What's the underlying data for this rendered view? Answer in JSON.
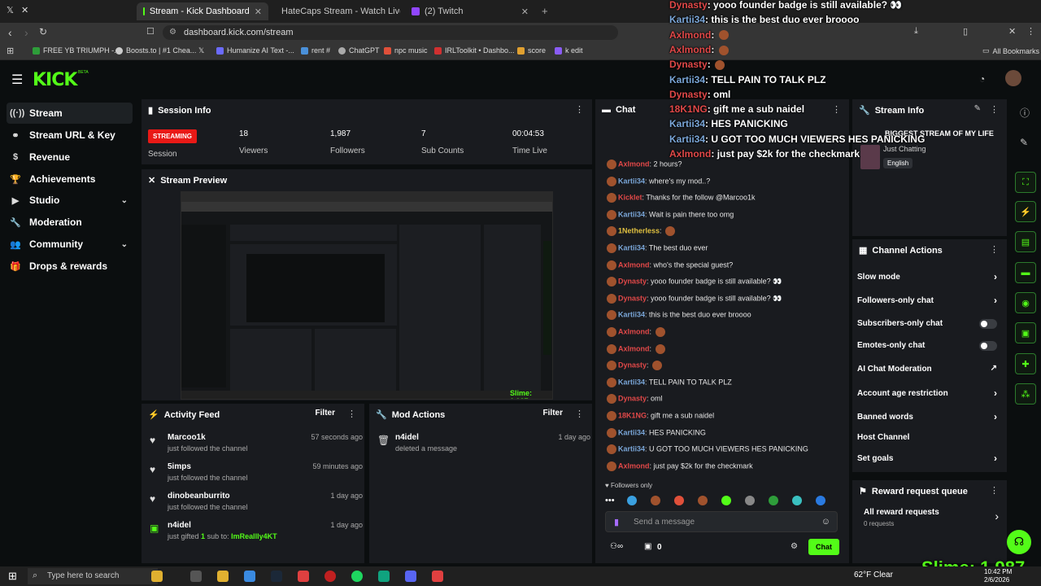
{
  "browser": {
    "tabs": [
      {
        "title": "Stream - Kick Dashboard",
        "active": true
      },
      {
        "title": "HateCaps Stream - Watch Live o",
        "active": false
      },
      {
        "title": "(2) Twitch",
        "active": false
      }
    ],
    "url": "dashboard.kick.com/stream",
    "bookmarks": [
      "FREE YB TRIUMPH -...",
      "Boosts.to | #1 Chea...",
      "Humanize AI Text -...",
      "rent #",
      "ChatGPT",
      "npc music",
      "IRLToolkit • Dashbo...",
      "score",
      "k edit"
    ],
    "all_bookmarks": "All Bookmarks"
  },
  "logo": "KICK",
  "logo_beta": "BETA",
  "sidebar": {
    "items": [
      {
        "label": "Stream",
        "icon": "broadcast-icon",
        "active": true
      },
      {
        "label": "Stream URL & Key",
        "icon": "link-icon",
        "active": false
      },
      {
        "label": "Revenue",
        "icon": "dollar-icon",
        "active": false
      },
      {
        "label": "Achievements",
        "icon": "trophy-icon",
        "active": false
      },
      {
        "label": "Studio",
        "icon": "video-icon",
        "active": false,
        "expandable": true
      },
      {
        "label": "Moderation",
        "icon": "wrench-icon",
        "active": false
      },
      {
        "label": "Community",
        "icon": "people-icon",
        "active": false,
        "expandable": true
      },
      {
        "label": "Drops & rewards",
        "icon": "gift-icon",
        "active": false
      }
    ]
  },
  "session": {
    "title": "Session Info",
    "status": "STREAMING",
    "status_label": "Session",
    "stats": [
      {
        "value": "18",
        "label": "Viewers"
      },
      {
        "value": "1,987",
        "label": "Followers"
      },
      {
        "value": "7",
        "label": "Sub Counts"
      },
      {
        "value": "00:04:53",
        "label": "Time Live"
      }
    ]
  },
  "preview": {
    "title": "Stream Preview"
  },
  "activity": {
    "title": "Activity Feed",
    "filter": "Filter",
    "items": [
      {
        "name": "Marcoo1k",
        "text": "just followed the channel",
        "time": "57 seconds ago",
        "icon": "heart-icon"
      },
      {
        "name": "5imps",
        "text": "just followed the channel",
        "time": "59 minutes ago",
        "icon": "heart-icon"
      },
      {
        "name": "dinobeanburrito",
        "text": "just followed the channel",
        "time": "1 day ago",
        "icon": "heart-icon"
      },
      {
        "name": "n4idel",
        "text": "just gifted",
        "count": "1",
        "text2": "sub to:",
        "target": "ImReallly4KT",
        "time": "1 day ago",
        "icon": "gift-icon"
      }
    ]
  },
  "modactions": {
    "title": "Mod Actions",
    "filter": "Filter",
    "items": [
      {
        "name": "n4idel",
        "text": "deleted a message",
        "time": "1 day ago"
      }
    ]
  },
  "chat": {
    "title": "Chat",
    "messages": [
      {
        "user": "Axlmond",
        "color": "#e04848",
        "text": "2 hours?"
      },
      {
        "user": "Kartii34",
        "color": "#7aa6d8",
        "text": "where's my mod..?"
      },
      {
        "user": "Kicklet",
        "color": "#e04848",
        "text": "Thanks for the follow @Marcoo1k"
      },
      {
        "user": "Kartii34",
        "color": "#7aa6d8",
        "text": "Wait is pain there too omg"
      },
      {
        "user": "1Netherless",
        "color": "#e0c040",
        "text": ""
      },
      {
        "user": "Kartii34",
        "color": "#7aa6d8",
        "text": "The best duo ever"
      },
      {
        "user": "Axlmond",
        "color": "#e04848",
        "text": "who's the special guest?"
      },
      {
        "user": "Dynasty",
        "color": "#e04848",
        "text": "yooo founder badge is still available? 👀"
      },
      {
        "user": "Dynasty",
        "color": "#e04848",
        "text": "yooo founder badge is still available? 👀"
      },
      {
        "user": "Kartii34",
        "color": "#7aa6d8",
        "text": "this is the best duo ever broooo"
      },
      {
        "user": "Axlmond",
        "color": "#e04848",
        "text": ""
      },
      {
        "user": "Axlmond",
        "color": "#e04848",
        "text": ""
      },
      {
        "user": "Dynasty",
        "color": "#e04848",
        "text": ""
      },
      {
        "user": "Kartii34",
        "color": "#7aa6d8",
        "text": "TELL PAIN TO TALK PLZ"
      },
      {
        "user": "Dynasty",
        "color": "#e04848",
        "text": "oml"
      },
      {
        "user": "18K1NG",
        "color": "#e04848",
        "text": "gift me a sub naidel"
      },
      {
        "user": "Kartii34",
        "color": "#7aa6d8",
        "text": "HES PANICKING"
      },
      {
        "user": "Kartii34",
        "color": "#7aa6d8",
        "text": "U GOT TOO MUCH VIEWERS HES PANICKING"
      },
      {
        "user": "Axlmond",
        "color": "#e04848",
        "text": "just pay $2k for the checkmark"
      }
    ],
    "mode": "Followers only",
    "placeholder": "Send a message",
    "users_count": "0",
    "send_label": "Chat"
  },
  "overlay": [
    {
      "user": "Dynasty",
      "color": "#e04848",
      "text": "yooo founder badge is still available? 👀"
    },
    {
      "user": "Kartii34",
      "color": "#7aa6d8",
      "text": "this is the best duo ever broooo"
    },
    {
      "user": "Axlmond",
      "color": "#e04848",
      "text": ""
    },
    {
      "user": "Axlmond",
      "color": "#e04848",
      "text": ""
    },
    {
      "user": "Dynasty",
      "color": "#e04848",
      "text": ""
    },
    {
      "user": "Kartii34",
      "color": "#7aa6d8",
      "text": "TELL PAIN TO TALK PLZ"
    },
    {
      "user": "Dynasty",
      "color": "#e04848",
      "text": "oml"
    },
    {
      "user": "18K1NG",
      "color": "#e04848",
      "text": "gift me a sub naidel"
    },
    {
      "user": "Kartii34",
      "color": "#7aa6d8",
      "text": "HES PANICKING"
    },
    {
      "user": "Kartii34",
      "color": "#7aa6d8",
      "text": "U GOT TOO MUCH VIEWERS HES PANICKING"
    },
    {
      "user": "Axlmond",
      "color": "#e04848",
      "text": "just pay $2k for the checkmark"
    }
  ],
  "streaminfo": {
    "title": "Stream Info",
    "stream_title": "BIGGEST STREAM OF MY LIFE",
    "category": "Just Chatting",
    "language": "English"
  },
  "channel_actions": {
    "title": "Channel Actions",
    "items": [
      {
        "label": "Slow mode",
        "control": "arrow"
      },
      {
        "label": "Followers-only chat",
        "control": "arrow"
      },
      {
        "label": "Subscribers-only chat",
        "control": "toggle"
      },
      {
        "label": "Emotes-only chat",
        "control": "toggle"
      },
      {
        "label": "AI Chat Moderation",
        "control": "external"
      },
      {
        "label": "Account age restriction",
        "control": "arrow"
      },
      {
        "label": "Banned words",
        "control": "arrow"
      },
      {
        "label": "Host Channel",
        "control": "none"
      },
      {
        "label": "Set goals",
        "control": "arrow"
      }
    ]
  },
  "rewards": {
    "title": "Reward request queue",
    "all": "All reward requests",
    "count": "0 requests"
  },
  "taskbar": {
    "search_placeholder": "Type here to search",
    "weather": "62°F  Clear",
    "time": "10:42 PM",
    "date": "2/6/2026"
  },
  "overlay_slime": "Slime: 1,987",
  "colors": {
    "accent": "#53fc18",
    "live": "#e91916",
    "panel": "#191b1f",
    "bg": "#0b0e0f"
  }
}
